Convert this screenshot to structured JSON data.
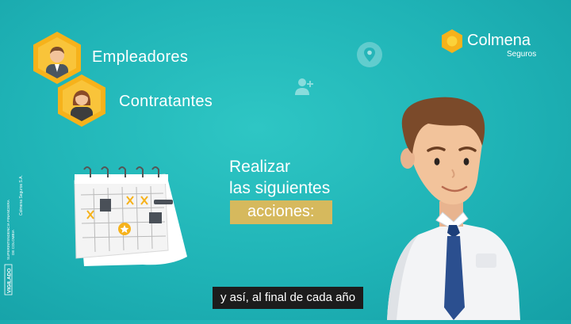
{
  "roles": [
    {
      "label": "Empleadores"
    },
    {
      "label": "Contratantes"
    }
  ],
  "logo": {
    "brand": "Colmena",
    "subtitle": "Seguros"
  },
  "headline": {
    "line1": "Realizar",
    "line2": "las siguientes",
    "highlight": "acciones:"
  },
  "subtitle_caption": "y así, al final de cada año",
  "legal": {
    "vigilado": "VIGILADO",
    "supervisor": "SUPERINTENDENCIA FINANCIERA",
    "country": "DE COLOMBIA",
    "company": "Colmena Seguros S.A."
  },
  "icons": [
    "employer-avatar-icon",
    "contractor-avatar-icon",
    "location-pin-icon",
    "add-user-icon",
    "calendar-icon"
  ],
  "colors": {
    "background": "#1fb3b6",
    "accent_yellow": "#f6b21b",
    "highlight": "#d6b95d",
    "caption_bg": "#1c1c1c"
  }
}
